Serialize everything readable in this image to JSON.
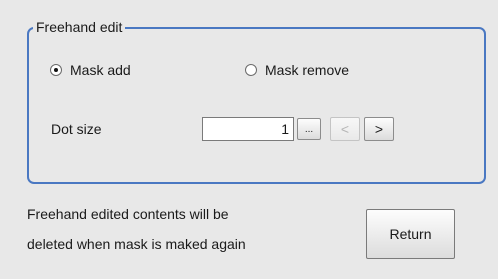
{
  "group": {
    "title": "Freehand edit"
  },
  "mode": {
    "mask_add": {
      "label": "Mask add",
      "checked": true
    },
    "mask_remove": {
      "label": "Mask remove",
      "checked": false
    }
  },
  "dot_size": {
    "label": "Dot size",
    "value": "1",
    "more_label": "...",
    "prev_label": "<",
    "next_label": ">"
  },
  "notice": {
    "line1": "Freehand edited contents will be",
    "line2": "deleted when mask is maked again"
  },
  "return_button": {
    "label": "Return"
  }
}
